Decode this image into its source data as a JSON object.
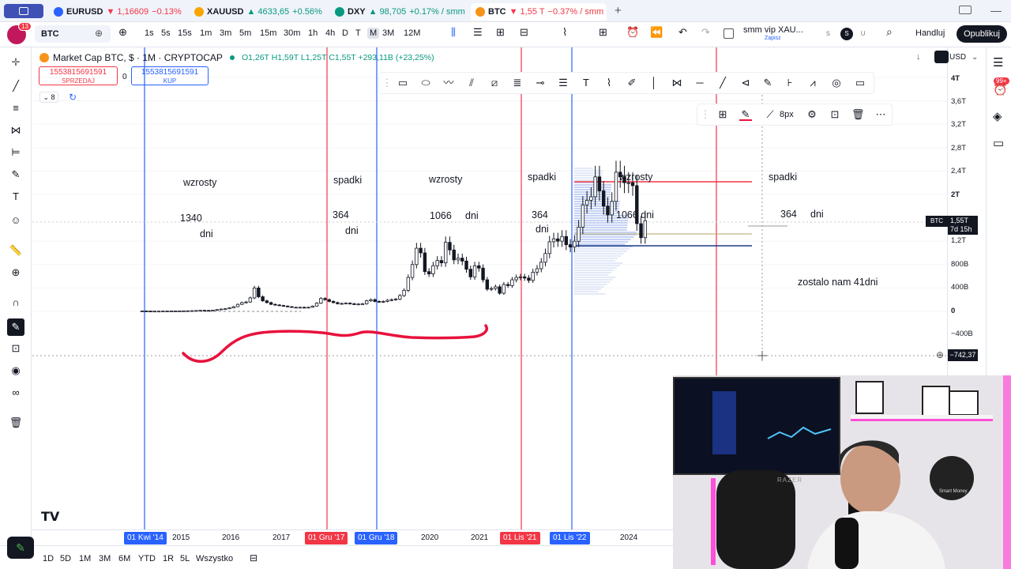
{
  "browser_tabs": [
    {
      "label": "EURUSD",
      "change": "▼ 1,16609",
      "pct": "−0.13%",
      "dir": "down",
      "color": "#2962ff"
    },
    {
      "label": "XAUUSD",
      "change": "▲ 4633,65",
      "pct": "+0.56%",
      "dir": "up",
      "color": "#f7a600"
    },
    {
      "label": "DXY",
      "change": "▲ 98,705",
      "pct": "+0.17% / smm",
      "dir": "up",
      "color": "#089981"
    },
    {
      "label": "BTC",
      "change": "▼ 1,55 T",
      "pct": "−0.37% / smm",
      "dir": "down",
      "color": "#f7931a"
    }
  ],
  "toolbar": {
    "symbol": "BTC",
    "timeframes": [
      "1s",
      "5s",
      "15s",
      "1m",
      "3m",
      "5m",
      "15m",
      "30m",
      "1h",
      "4h",
      "D",
      "T",
      "M",
      "3M",
      "12M"
    ],
    "active_timeframe": "M",
    "layout_name": "smm vip XAU...",
    "layout_sub": "Zapisz",
    "trade_label": "Handluj",
    "publish_label": "Opublikuj",
    "notif_count": "13"
  },
  "legend": {
    "title": "Market Cap BTC, $ · 1M · CRYPTOCAP",
    "ohlc": "O1,26T H1,59T L1,25T C1,55T +293,11B (+23,25%)"
  },
  "sell_box": {
    "value": "1553815691591",
    "label": "SPRZEDAJ"
  },
  "spread": "0",
  "buy_box": {
    "value": "1553815691591",
    "label": "KUP"
  },
  "indicator_count": "8",
  "annotations": [
    {
      "text": "wzrosty"
    },
    {
      "text": "spadki"
    },
    {
      "text": "wzrosty"
    },
    {
      "text": "spadki"
    },
    {
      "text": "wzrosty"
    },
    {
      "text": "spadki"
    },
    {
      "text": "1340"
    },
    {
      "text": "dni"
    },
    {
      "text": "364"
    },
    {
      "text": "dni"
    },
    {
      "text": "1066"
    },
    {
      "text": "dni"
    },
    {
      "text": "364"
    },
    {
      "text": "dni"
    },
    {
      "text": "1066 dni"
    },
    {
      "text": "364"
    },
    {
      "text": "dni"
    },
    {
      "text": "zostalo nam 41dni"
    }
  ],
  "prop_bar": {
    "width_label": "8px"
  },
  "price_axis": {
    "currency": "USD",
    "labels": [
      "4T",
      "3,6T",
      "3,2T",
      "2,8T",
      "2,4T",
      "2T",
      "1,2T",
      "800B",
      "400B",
      "0",
      "−400B"
    ],
    "btc_tag": "BTC",
    "btc_price": "1,55T",
    "btc_countdown": "7d 15h",
    "cursor_price": "−742,37"
  },
  "time_axis": {
    "years": [
      "2015",
      "2016",
      "2017",
      "2020",
      "2021",
      "2024"
    ],
    "vertical_labels": [
      {
        "text": "01 Kwi '14",
        "color": "#2962ff"
      },
      {
        "text": "01 Gru '17",
        "color": "#f23645"
      },
      {
        "text": "01 Gru '18",
        "color": "#2962ff"
      },
      {
        "text": "01 Lis '21",
        "color": "#f23645"
      },
      {
        "text": "01 Lis '22",
        "color": "#2962ff"
      }
    ]
  },
  "bottom_bar": {
    "ranges": [
      "1D",
      "5D",
      "1M",
      "3M",
      "6M",
      "YTD",
      "1R",
      "5L",
      "Wszystko"
    ]
  },
  "right_badge": "99+",
  "webcam_text": {
    "razer": "RAZER",
    "brand": "Smart Money"
  },
  "colors": {
    "up": "#089981",
    "down": "#f23645",
    "vline_red": "#f23645",
    "vline_blue": "#2962ff",
    "accent": "#2962ff",
    "red_stroke": "#e8123c"
  },
  "chart_data": {
    "type": "candlestick",
    "series": [
      {
        "name": "Market Cap BTC, $ · 1M · CRYPTOCAP",
        "unit": "USD",
        "close": [
          0.006,
          0.005,
          0.004,
          0.004,
          0.004,
          0.005,
          0.005,
          0.006,
          0.007,
          0.008,
          0.009,
          0.01,
          0.012,
          0.015,
          0.018,
          0.017,
          0.016,
          0.02,
          0.03,
          0.04,
          0.045,
          0.06,
          0.08,
          0.12,
          0.15,
          0.16,
          0.23,
          0.4,
          0.25,
          0.18,
          0.15,
          0.12,
          0.11,
          0.1,
          0.09,
          0.08,
          0.07,
          0.07,
          0.07,
          0.065,
          0.07,
          0.09,
          0.14,
          0.22,
          0.2,
          0.17,
          0.15,
          0.13,
          0.135,
          0.14,
          0.13,
          0.12,
          0.125,
          0.13,
          0.18,
          0.2,
          0.17,
          0.16,
          0.17,
          0.19,
          0.2,
          0.21,
          0.27,
          0.36,
          0.58,
          0.8,
          1.08,
          1.0,
          0.68,
          0.64,
          0.78,
          0.87,
          0.83,
          1.18,
          1.05,
          0.88,
          0.91,
          0.86,
          0.72,
          0.59,
          0.78,
          0.74,
          0.54,
          0.38,
          0.39,
          0.42,
          0.31,
          0.46,
          0.44,
          0.54,
          0.58,
          0.59,
          0.57,
          0.53,
          0.67,
          0.73,
          0.84,
          0.99,
          1.19,
          1.24,
          1.2,
          1.28,
          1.14,
          1.1,
          1.2,
          1.44,
          1.82,
          1.9,
          1.96,
          2.3,
          2.06,
          1.8,
          1.65,
          1.88,
          2.38,
          2.3,
          2.2,
          2.2,
          2.15,
          1.5,
          1.26,
          1.55
        ]
      }
    ],
    "ylim": [
      -0.5,
      4.2
    ]
  }
}
